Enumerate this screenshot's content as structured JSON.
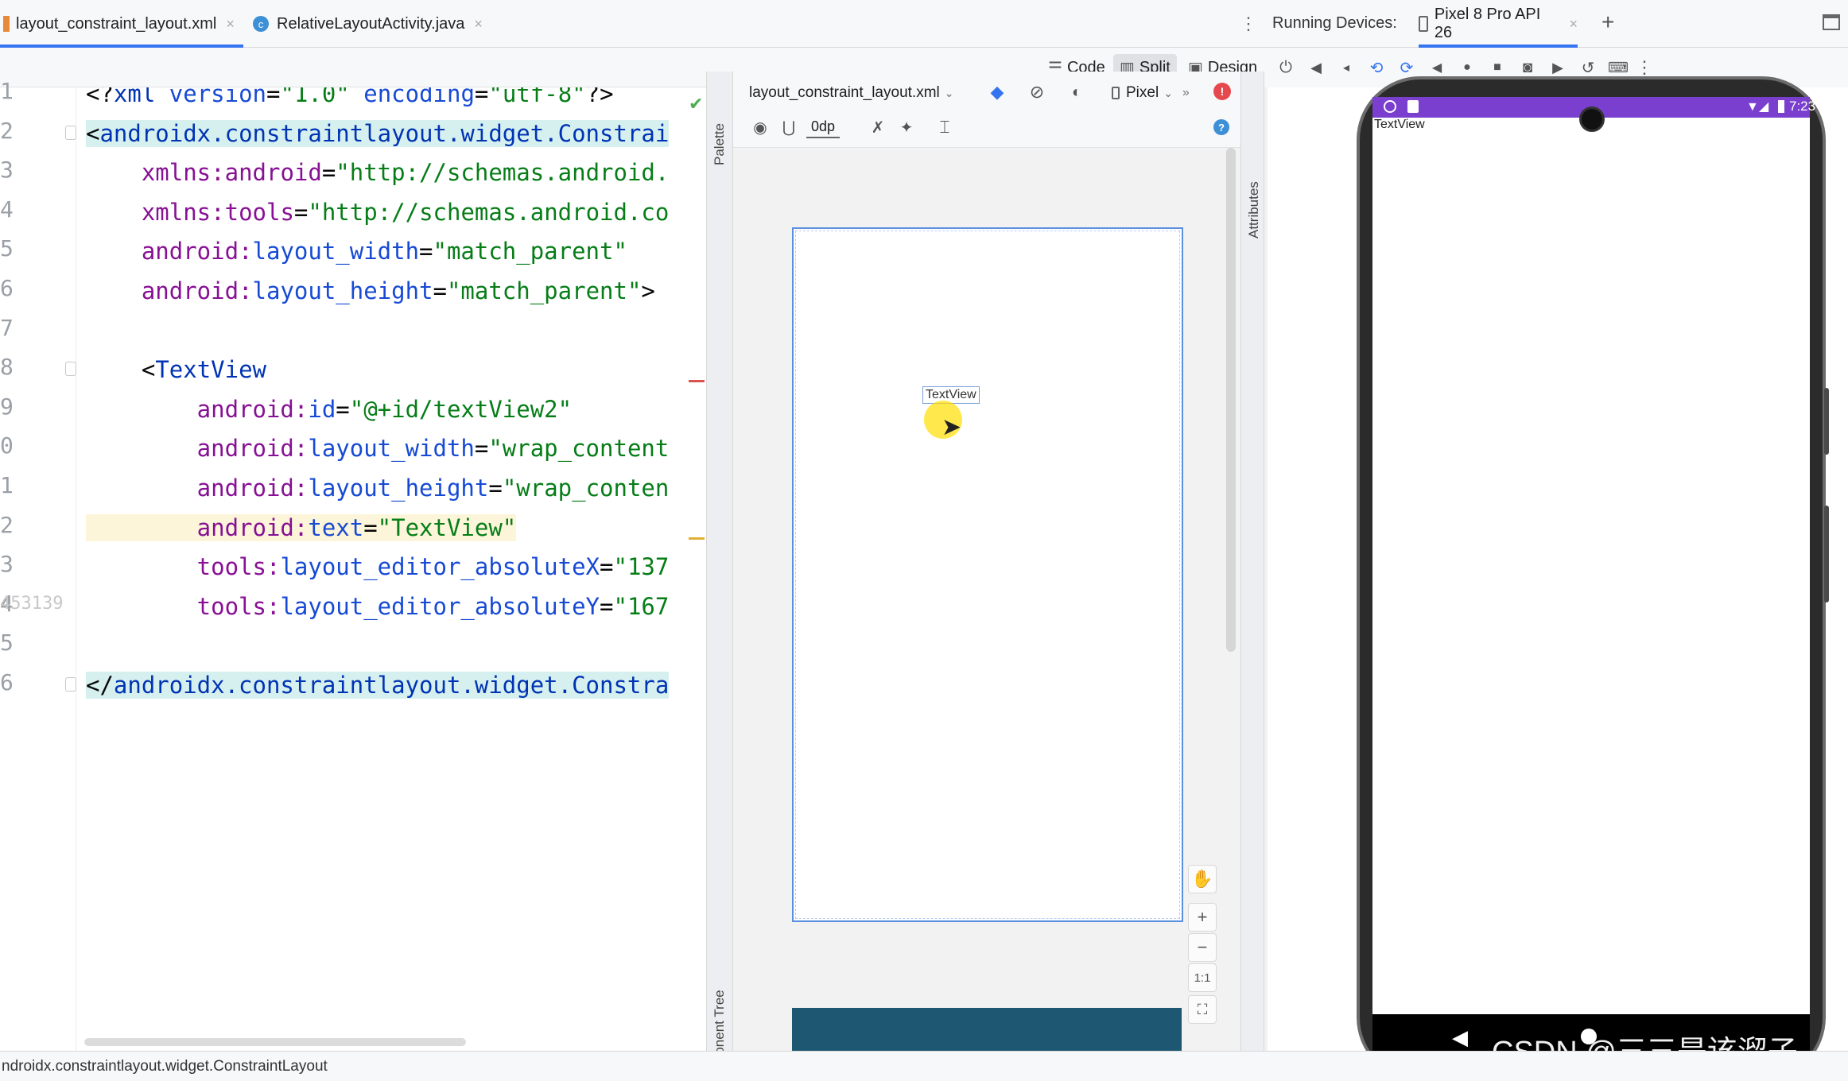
{
  "tabs": [
    {
      "label": "layout_constraint_layout.xml",
      "active": true
    },
    {
      "label": "RelativeLayoutActivity.java",
      "active": false
    }
  ],
  "tab_close": "×",
  "modes": {
    "code": "Code",
    "split": "Split",
    "design": "Design"
  },
  "editor": {
    "line_numbers": [
      "1",
      "2",
      "3",
      "4",
      "5",
      "6",
      "7",
      "8",
      "9",
      "0",
      "1",
      "2",
      "3",
      "4",
      "5",
      "6"
    ],
    "gutter_overlay": "453139",
    "lines": [
      {
        "parts": [
          [
            "<?",
            "pun"
          ],
          [
            "xml",
            "tag"
          ],
          [
            " version",
            "attr"
          ],
          [
            "=",
            "pun"
          ],
          [
            "\"1.0\"",
            "val"
          ],
          [
            " encoding",
            "attr"
          ],
          [
            "=",
            "pun"
          ],
          [
            "\"utf-8\"",
            "val"
          ],
          [
            "?>",
            "pun"
          ]
        ]
      },
      {
        "parts": [
          [
            "<",
            "pun"
          ],
          [
            "androidx.constraintlayout.widget.Constrai",
            "tag"
          ]
        ],
        "hl": "tag"
      },
      {
        "parts": [
          [
            "    xmlns:",
            "ns"
          ],
          [
            "android",
            "ns"
          ],
          [
            "=",
            "pun"
          ],
          [
            "\"http://schemas.android.",
            "val"
          ]
        ]
      },
      {
        "parts": [
          [
            "    xmlns:",
            "ns"
          ],
          [
            "tools",
            "ns"
          ],
          [
            "=",
            "pun"
          ],
          [
            "\"http://schemas.android.co",
            "val"
          ]
        ]
      },
      {
        "parts": [
          [
            "    android:",
            "ns"
          ],
          [
            "layout_width",
            "attr"
          ],
          [
            "=",
            "pun"
          ],
          [
            "\"match_parent\"",
            "val"
          ]
        ]
      },
      {
        "parts": [
          [
            "    android:",
            "ns"
          ],
          [
            "layout_height",
            "attr"
          ],
          [
            "=",
            "pun"
          ],
          [
            "\"match_parent\"",
            "val"
          ],
          [
            ">",
            "pun"
          ]
        ]
      },
      {
        "parts": []
      },
      {
        "parts": [
          [
            "    <",
            "pun"
          ],
          [
            "TextView",
            "tag"
          ]
        ]
      },
      {
        "parts": [
          [
            "        android:",
            "ns"
          ],
          [
            "id",
            "attr"
          ],
          [
            "=",
            "pun"
          ],
          [
            "\"@+id/textView2\"",
            "val"
          ]
        ]
      },
      {
        "parts": [
          [
            "        android:",
            "ns"
          ],
          [
            "layout_width",
            "attr"
          ],
          [
            "=",
            "pun"
          ],
          [
            "\"wrap_content",
            "val"
          ]
        ]
      },
      {
        "parts": [
          [
            "        android:",
            "ns"
          ],
          [
            "layout_height",
            "attr"
          ],
          [
            "=",
            "pun"
          ],
          [
            "\"wrap_conten",
            "val"
          ]
        ]
      },
      {
        "parts": [
          [
            "        android:",
            "ns"
          ],
          [
            "text",
            "attr"
          ],
          [
            "=",
            "pun"
          ],
          [
            "\"TextView\"",
            "val"
          ]
        ],
        "hl": "line"
      },
      {
        "parts": [
          [
            "        tools:",
            "ns"
          ],
          [
            "layout_editor_absoluteX",
            "attr"
          ],
          [
            "=",
            "pun"
          ],
          [
            "\"137",
            "val"
          ]
        ]
      },
      {
        "parts": [
          [
            "        tools:",
            "ns"
          ],
          [
            "layout_editor_absoluteY",
            "attr"
          ],
          [
            "=",
            "pun"
          ],
          [
            "\"167",
            "val"
          ]
        ]
      },
      {
        "parts": []
      },
      {
        "parts": [
          [
            "</",
            "pun"
          ],
          [
            "androidx.constraintlayout.widget.Constra",
            "tag"
          ]
        ],
        "hl": "tag"
      }
    ]
  },
  "side_labels": {
    "palette": "Palette",
    "component_tree": "Component Tree",
    "attributes": "Attributes"
  },
  "design": {
    "file_dropdown": "layout_constraint_layout.xml",
    "device_dropdown": "Pixel",
    "margin_value": "0dp",
    "widget_text": "TextView",
    "zoom": {
      "plus": "+",
      "minus": "−",
      "one_to_one": "1:1"
    }
  },
  "devices": {
    "label": "Running Devices:",
    "tab": "Pixel 8 Pro API 26",
    "add": "+",
    "emulator_time": "7:23",
    "emulator_text": "TextView"
  },
  "status_bar": {
    "text": "ndroidx.constraintlayout.widget.ConstraintLayout"
  },
  "watermark": "CSDN @三三是该溜子",
  "colors": {
    "accent": "#3574f0",
    "statusbar": "#7a3fcf",
    "blueprint": "#1e5771"
  }
}
